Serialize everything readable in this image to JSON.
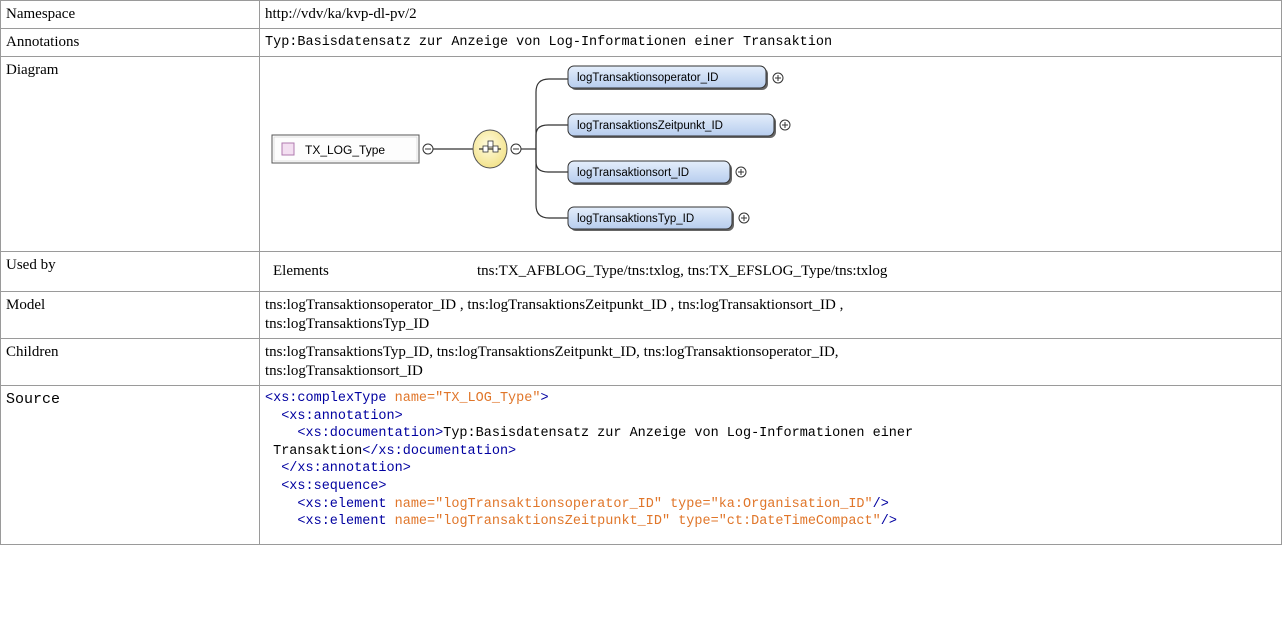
{
  "rows": {
    "namespace": {
      "label": "Namespace",
      "value": "http://vdv/ka/kvp-dl-pv/2"
    },
    "annotations": {
      "label": "Annotations",
      "value": "Typ:Basisdatensatz zur Anzeige von Log-Informationen einer Transaktion"
    },
    "diagram": {
      "label": "Diagram",
      "type_name": "TX_LOG_Type",
      "children": [
        "logTransaktionsoperator_ID",
        "logTransaktionsZeitpunkt_ID",
        "logTransaktionsort_ID",
        "logTransaktionsTyp_ID"
      ]
    },
    "used_by": {
      "label": "Used by",
      "kind": "Elements",
      "value": "tns:TX_AFBLOG_Type/tns:txlog, tns:TX_EFSLOG_Type/tns:txlog"
    },
    "model": {
      "label": "Model",
      "line1": "tns:logTransaktionsoperator_ID , tns:logTransaktionsZeitpunkt_ID , tns:logTransaktionsort_ID ,",
      "line2": "tns:logTransaktionsTyp_ID"
    },
    "children": {
      "label": "Children",
      "line1": "tns:logTransaktionsTyp_ID, tns:logTransaktionsZeitpunkt_ID, tns:logTransaktionsoperator_ID,",
      "line2": "tns:logTransaktionsort_ID"
    },
    "source": {
      "label": "Source",
      "ct_open": "<xs:complexType",
      "ct_attr": " name=",
      "ct_name": "\"TX_LOG_Type\"",
      "gt": ">",
      "ann_open": "<xs:annotation>",
      "doc_open": "<xs:documentation>",
      "doc_text1": "Typ:Basisdatensatz zur Anzeige von Log-Informationen einer",
      "doc_text2": "Transaktion",
      "doc_close": "</xs:documentation>",
      "ann_close": "</xs:annotation>",
      "seq_open": "<xs:sequence>",
      "el1_open": "<xs:element",
      "el1_name_attr": " name=",
      "el1_name": "\"logTransaktionsoperator_ID\"",
      "el1_type_attr": " type=",
      "el1_type": "\"ka:Organisation_ID\"",
      "el1_close": "/>",
      "el2_open": "<xs:element",
      "el2_name_attr": " name=",
      "el2_name": "\"logTransaktionsZeitpunkt_ID\"",
      "el2_type_attr": " type=",
      "el2_type": "\"ct:DateTimeCompact\"",
      "el2_close": "/>"
    }
  },
  "colors": {
    "element_fill": "#c9daf2",
    "element_border": "#3a3a3a",
    "type_box_fill": "#ffffff",
    "compositor_fill": "#fbf4b6",
    "tag": "#0000a0",
    "attr": "#e0762a"
  }
}
